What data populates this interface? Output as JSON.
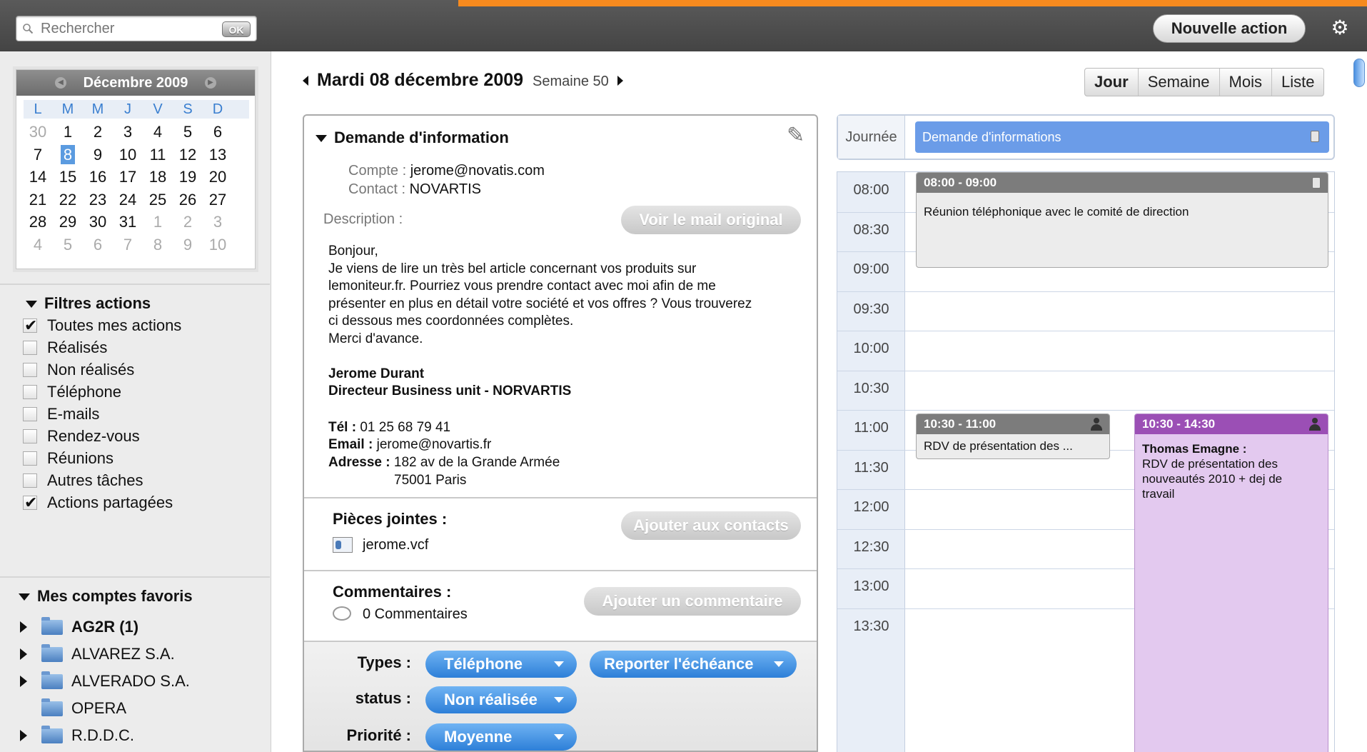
{
  "topbar": {
    "search_placeholder": "Rechercher",
    "search_ok": "OK",
    "new_action": "Nouvelle action",
    "accent": "#f78a1e"
  },
  "calendar": {
    "month_label": "Décembre 2009",
    "dow": [
      "L",
      "M",
      "M",
      "J",
      "V",
      "S",
      "D"
    ],
    "weeks": [
      [
        "30",
        "1",
        "2",
        "3",
        "4",
        "5",
        "6"
      ],
      [
        "7",
        "8",
        "9",
        "10",
        "11",
        "12",
        "13"
      ],
      [
        "14",
        "15",
        "16",
        "17",
        "18",
        "19",
        "20"
      ],
      [
        "21",
        "22",
        "23",
        "24",
        "25",
        "26",
        "27"
      ],
      [
        "28",
        "29",
        "30",
        "31",
        "1",
        "2",
        "3"
      ],
      [
        "4",
        "5",
        "6",
        "7",
        "8",
        "9",
        "10"
      ]
    ],
    "today": "8"
  },
  "filters": {
    "title": "Filtres actions",
    "items": [
      {
        "label": "Toutes mes actions",
        "checked": true
      },
      {
        "label": "Réalisés",
        "checked": false
      },
      {
        "label": "Non réalisés",
        "checked": false
      },
      {
        "label": "Téléphone",
        "checked": false
      },
      {
        "label": "E-mails",
        "checked": false
      },
      {
        "label": "Rendez-vous",
        "checked": false
      },
      {
        "label": "Réunions",
        "checked": false
      },
      {
        "label": "Autres tâches",
        "checked": false
      },
      {
        "label": "Actions partagées",
        "checked": true
      }
    ]
  },
  "favorites": {
    "title": "Mes comptes favoris",
    "items": [
      {
        "label": "AG2R (1)",
        "bold": true,
        "expandable": true
      },
      {
        "label": "ALVAREZ S.A.",
        "bold": false,
        "expandable": true
      },
      {
        "label": "ALVERADO S.A.",
        "bold": false,
        "expandable": true
      },
      {
        "label": "OPERA",
        "bold": false,
        "expandable": false
      },
      {
        "label": "R.D.D.C.",
        "bold": false,
        "expandable": true
      }
    ]
  },
  "header": {
    "date": "Mardi 08 décembre 2009",
    "week": "Semaine 50",
    "views": [
      "Jour",
      "Semaine",
      "Mois",
      "Liste"
    ],
    "active_view": "Jour"
  },
  "detail": {
    "title": "Demande d'information",
    "compte_key": "Compte :",
    "compte_val": "jerome@novatis.com",
    "contact_key": "Contact :",
    "contact_val": "NOVARTIS",
    "description_key": "Description :",
    "voir_mail": "Voir le mail original",
    "body": {
      "l1": "Bonjour,",
      "l2": "Je viens de lire un très bel article concernant vos produits sur",
      "l3": "lemoniteur.fr. Pourriez vous prendre contact avec moi afin de me",
      "l4": "présenter en plus en détail votre société et vos offres ? Vous trouverez",
      "l5": "ci dessous mes coordonnées complètes.",
      "l6": "Merci d'avance.",
      "sig_name": "Jerome Durant",
      "sig_title": "Directeur Business unit - NORVARTIS",
      "tel_key": "Tél :",
      "tel_val": " 01 25 68 79 41",
      "email_key": "Email :",
      "email_val": " jerome@novartis.fr",
      "addr_key": "Adresse :",
      "addr_val": " 182 av de la Grande Armée",
      "addr_city": "75001 Paris"
    },
    "attachments_title": "Pièces jointes :",
    "attachment_file": "jerome.vcf",
    "add_contacts": "Ajouter aux contacts",
    "comments_title": "Commentaires :",
    "comments_count": "0 Commentaires",
    "add_comment": "Ajouter un commentaire",
    "types_label": "Types :",
    "types_value": "Téléphone",
    "report_label": "Reporter l'échéance",
    "status_label": "status :",
    "status_value": "Non réalisée",
    "priority_label": "Priorité :",
    "priority_value": "Moyenne"
  },
  "agenda": {
    "allday_label": "Journée",
    "allday_event": "Demande d'informations",
    "slots": [
      "08:00",
      "08:30",
      "09:00",
      "09:30",
      "10:00",
      "10:30",
      "11:00",
      "11:30",
      "12:00",
      "12:30",
      "13:00",
      "13:30"
    ],
    "events": [
      {
        "time": "08:00 - 09:00",
        "text": "Réunion téléphonique avec le comité de direction"
      },
      {
        "time": "10:30 - 11:00",
        "text": "RDV de présentation des ..."
      },
      {
        "time": "10:30 - 14:30",
        "who": "Thomas Emagne :",
        "text1": "RDV de présentation des",
        "text2": "nouveautés 2010 + dej de",
        "text3": "travail"
      }
    ],
    "colors": {
      "allday": "#6b9ce8",
      "grey_event": "#7c7c7c",
      "purple_head": "#9b4fb5",
      "purple_body": "#e3c9ef"
    }
  }
}
